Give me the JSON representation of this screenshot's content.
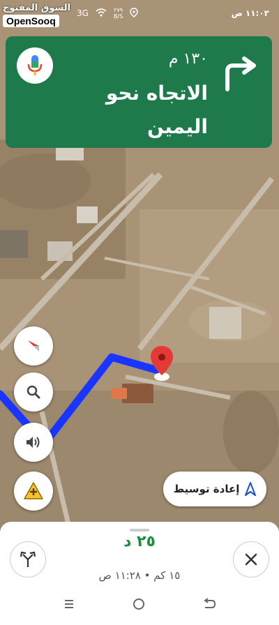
{
  "status_bar": {
    "time": "١١:٠٣ ص",
    "network_speed_value": "٢٧٩",
    "network_speed_unit": "B/S",
    "signal_label": "3G"
  },
  "watermark": {
    "arabic_text": "السوق المفتوح",
    "brand": "OpenSooq"
  },
  "banner": {
    "distance": "١٣٠ م",
    "instruction": "الاتجاه نحو اليمين",
    "color": "#1e7a4a"
  },
  "controls": {
    "recenter_label": "إعادة توسيط"
  },
  "trip": {
    "duration": "٢٥ د",
    "distance": "١٥ كم",
    "arrival_time": "١١:٢٨ ص",
    "separator": "•"
  },
  "icons": {
    "mic": "mic-icon",
    "turn": "turn-right-icon",
    "compass": "compass-icon",
    "search": "search-icon",
    "sound": "volume-icon",
    "report": "report-incident-icon",
    "alternate": "alternate-routes-icon",
    "close": "close-icon"
  },
  "colors": {
    "route": "#1a35ff",
    "eta": "#1e8e3e",
    "pin": "#e53935"
  }
}
